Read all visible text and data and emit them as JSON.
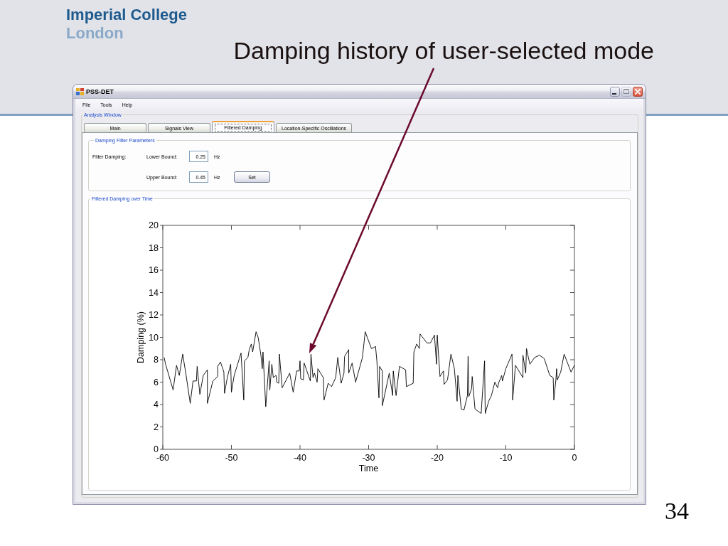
{
  "slide": {
    "logo": [
      "Imperial College",
      "London"
    ],
    "title": "Damping history of user-selected mode"
  },
  "window": {
    "title": "PSS-DET",
    "controls": [
      {
        "kind": "minimize",
        "disabled": false
      },
      {
        "kind": "maximize",
        "disabled": true
      },
      {
        "kind": "close",
        "disabled": false
      }
    ],
    "menu": [
      "File",
      "Tools",
      "Help"
    ],
    "group_title": "Analysis Window",
    "tabs": [
      {
        "label": "Main",
        "selected": false
      },
      {
        "label": "Signals View",
        "selected": false
      },
      {
        "label": "Filtered Damping",
        "selected": true
      },
      {
        "label": "Location-Specific Oscillations",
        "selected": false
      }
    ],
    "filter_group": {
      "title": "Damping Filter Parameters",
      "label": "Filter Damping:",
      "fields": [
        {
          "label": "Lower Bound:",
          "value": "0.25",
          "unit": "Hz"
        },
        {
          "label": "Upper Bound:",
          "value": "0.45",
          "unit": "Hz"
        }
      ],
      "button": "Set"
    },
    "plot_group": {
      "title": "Filtered Damping over Time",
      "chart_data": {
        "type": "line",
        "xlabel": "Time",
        "ylabel": "Damping (%)",
        "x": [
          -59.8,
          -59.6,
          -58.5,
          -58.0,
          -57.6,
          -57.1,
          -56.6,
          -56.0,
          -55.6,
          -55.1,
          -55.0,
          -54.6,
          -54.1,
          -53.5,
          -53.5,
          -52.7,
          -52.0,
          -52.0,
          -51.6,
          -51.1,
          -51.0,
          -50.6,
          -50.1,
          -50.0,
          -49.6,
          -48.6,
          -48.2,
          -48.1,
          -47.6,
          -47.4,
          -47.1,
          -46.9,
          -46.4,
          -46.1,
          -45.7,
          -45.5,
          -45.4,
          -45.0,
          -44.5,
          -44.4,
          -44.1,
          -43.9,
          -43.5,
          -43.4,
          -43.1,
          -43.0,
          -42.6,
          -41.5,
          -41.0,
          -40.5,
          -40.1,
          -40.0,
          -39.9,
          -39.5,
          -39.4,
          -38.5,
          -38.4,
          -38.1,
          -37.9,
          -37.5,
          -37.4,
          -36.6,
          -36.5,
          -35.9,
          -35.4,
          -34.8,
          -34.5,
          -34.0,
          -33.6,
          -33.5,
          -32.9,
          -32.9,
          -32.4,
          -31.9,
          -30.9,
          -30.5,
          -29.6,
          -29.2,
          -29.0,
          -28.8,
          -28.5,
          -28.4,
          -28.0,
          -28.0,
          -27.0,
          -26.5,
          -26.4,
          -26.0,
          -25.5,
          -24.6,
          -24.5,
          -23.5,
          -23.4,
          -23.0,
          -22.6,
          -22.5,
          -21.5,
          -21.0,
          -20.4,
          -20.1,
          -20.0,
          -19.6,
          -19.1,
          -19.0,
          -18.5,
          -18.0,
          -17.5,
          -17.1,
          -17.0,
          -16.5,
          -16.1,
          -15.6,
          -15.5,
          -15.4,
          -15.0,
          -14.9,
          -14.5,
          -13.6,
          -13.1,
          -13.0,
          -12.5,
          -12.1,
          -11.6,
          -11.2,
          -11.0,
          -10.6,
          -10.5,
          -10.0,
          -9.1,
          -9.0,
          -8.6,
          -7.5,
          -7.5,
          -7.1,
          -7.0,
          -6.5,
          -5.8,
          -5.1,
          -4.4,
          -3.6,
          -3.1,
          -3.0,
          -2.7,
          -2.6,
          -2.5,
          -2.0,
          -1.5,
          -0.5,
          0
        ],
        "series": [
          {
            "color": "#000000",
            "values": [
              8.2,
              7.6,
              5.3,
              7.5,
              6.6,
              8.5,
              6.6,
              4.1,
              6.1,
              6.1,
              7.4,
              4.9,
              6.6,
              7.1,
              4.1,
              6.1,
              6.5,
              7.4,
              7.8,
              6.9,
              5.0,
              6.4,
              7.6,
              5.1,
              6.6,
              8.6,
              4.4,
              7.9,
              8.2,
              8.9,
              9.4,
              8.7,
              10.5,
              10.0,
              8.4,
              7.2,
              8.7,
              3.8,
              7.9,
              5.3,
              7.6,
              6.4,
              6.6,
              6.0,
              5.9,
              8.5,
              5.5,
              6.8,
              5.1,
              7.0,
              7.0,
              7.9,
              6.3,
              6.2,
              7.7,
              6.1,
              8.5,
              6.4,
              6.8,
              6.0,
              7.2,
              6.4,
              4.4,
              5.9,
              5.6,
              6.4,
              8.2,
              5.9,
              6.8,
              8.3,
              8.9,
              6.8,
              7.7,
              6.0,
              8.2,
              10.5,
              9.0,
              9.1,
              9.2,
              7.9,
              4.6,
              7.4,
              7.0,
              3.9,
              6.8,
              4.8,
              7.0,
              4.8,
              7.4,
              7.1,
              5.6,
              5.9,
              8.7,
              9.4,
              9.0,
              10.3,
              9.5,
              9.5,
              10.2,
              7.6,
              10.2,
              6.5,
              7.0,
              5.8,
              6.2,
              8.5,
              7.2,
              4.3,
              6.6,
              3.6,
              3.5,
              4.8,
              8.3,
              4.7,
              5.4,
              6.5,
              3.6,
              3.2,
              7.9,
              3.2,
              4.3,
              4.8,
              6.0,
              5.5,
              6.0,
              6.6,
              6.1,
              7.2,
              8.5,
              4.4,
              7.5,
              6.4,
              8.4,
              6.8,
              9.0,
              7.6,
              8.2,
              8.4,
              8.1,
              6.6,
              6.4,
              4.4,
              6.2,
              7.2,
              6.2,
              6.9,
              8.5,
              6.9,
              7.5
            ]
          }
        ],
        "xlim": [
          -60,
          0
        ],
        "ylim": [
          0,
          20
        ],
        "xticks": [
          -60,
          -50,
          -40,
          -30,
          -20,
          -10,
          0
        ],
        "yticks": [
          0,
          2,
          4,
          6,
          8,
          10,
          12,
          14,
          16,
          18,
          20
        ]
      }
    }
  },
  "page_number": "34"
}
